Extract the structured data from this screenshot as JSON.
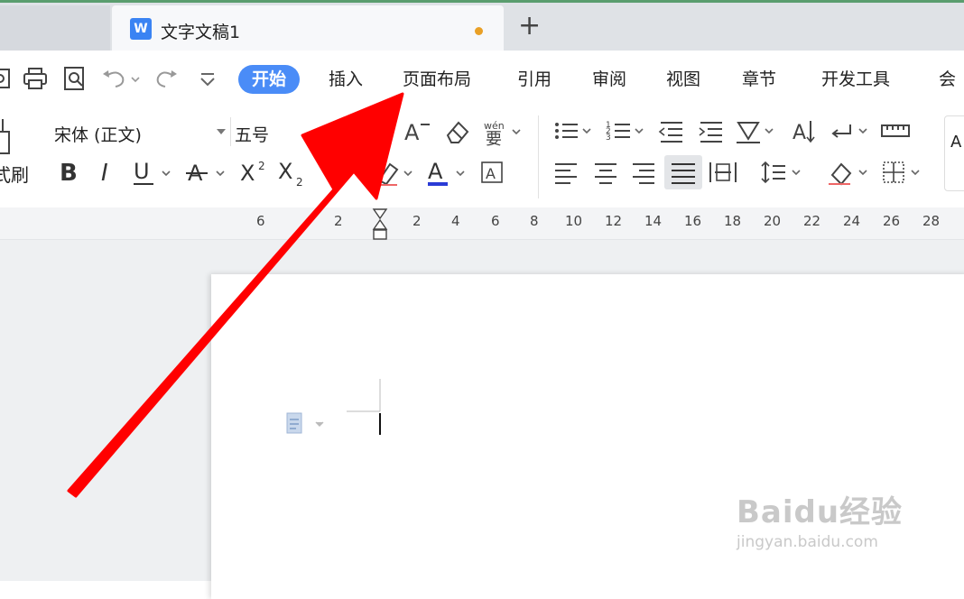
{
  "tabs": {
    "doc_title": "文字文稿1",
    "logo_letter": "W",
    "add_label": "+"
  },
  "menu": {
    "items": [
      "开始",
      "插入",
      "页面布局",
      "引用",
      "审阅",
      "视图",
      "章节",
      "开发工具",
      "会"
    ],
    "active": "开始"
  },
  "ribbon": {
    "brush_label": "式刷",
    "font_name": "宋体 (正文)",
    "font_size": "五号",
    "style_preview": "A"
  },
  "ruler": {
    "ticks": [
      "6",
      "2",
      "2",
      "4",
      "6",
      "8",
      "10",
      "12",
      "14",
      "16",
      "18",
      "20",
      "22",
      "24",
      "26",
      "28"
    ]
  },
  "watermark": {
    "brand": "Baidu经验",
    "url": "jingyan.baidu.com"
  },
  "colors": {
    "accent": "#4a8cf7",
    "arrow": "#ff0000",
    "unsaved_dot": "#e9a026"
  }
}
